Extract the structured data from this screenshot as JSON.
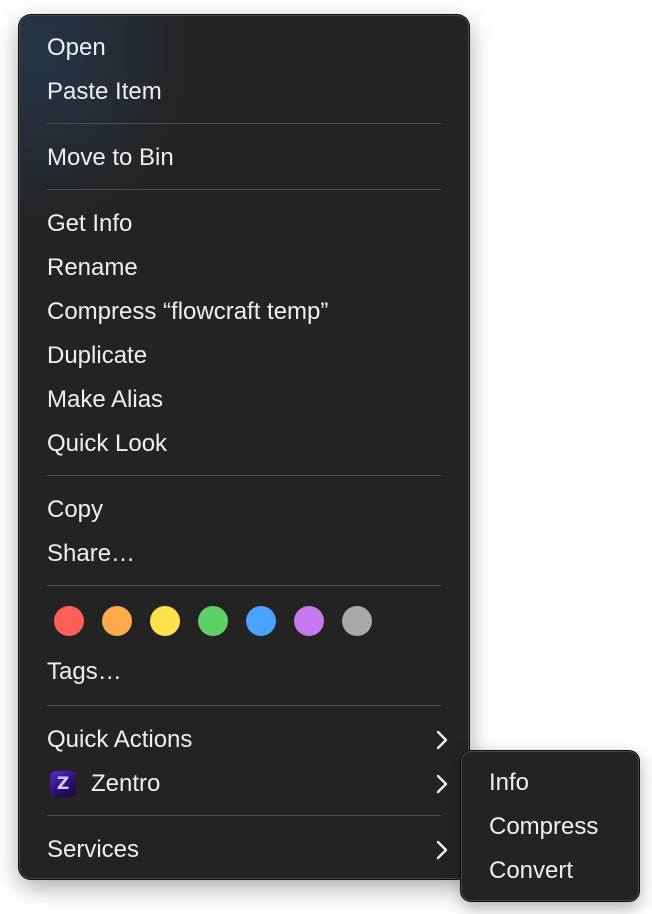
{
  "context_menu": {
    "items": {
      "open": "Open",
      "paste_item": "Paste Item",
      "move_to_bin": "Move to Bin",
      "get_info": "Get Info",
      "rename": "Rename",
      "compress": "Compress “flowcraft temp”",
      "duplicate": "Duplicate",
      "make_alias": "Make Alias",
      "quick_look": "Quick Look",
      "copy": "Copy",
      "share": "Share…",
      "tags": "Tags…",
      "quick_actions": "Quick Actions",
      "zentro": "Zentro",
      "services": "Services"
    },
    "zentro_icon_letter": "Z",
    "tag_colors": [
      {
        "name": "red",
        "hex": "#ff5f57"
      },
      {
        "name": "orange",
        "hex": "#ffa94d"
      },
      {
        "name": "yellow",
        "hex": "#ffe14d"
      },
      {
        "name": "green",
        "hex": "#5fd068"
      },
      {
        "name": "blue",
        "hex": "#4ba3ff"
      },
      {
        "name": "purple",
        "hex": "#c678ee"
      },
      {
        "name": "gray",
        "hex": "#a9a9a9"
      }
    ]
  },
  "zentro_submenu": {
    "items": {
      "info": "Info",
      "compress": "Compress",
      "convert": "Convert"
    }
  },
  "icons": {
    "submenu_chevron": "chevron-right-icon",
    "zentro": "zentro-app-icon"
  },
  "colors": {
    "menu_background": "#232323",
    "text": "#efefef",
    "separator": "#4d4d4d"
  }
}
